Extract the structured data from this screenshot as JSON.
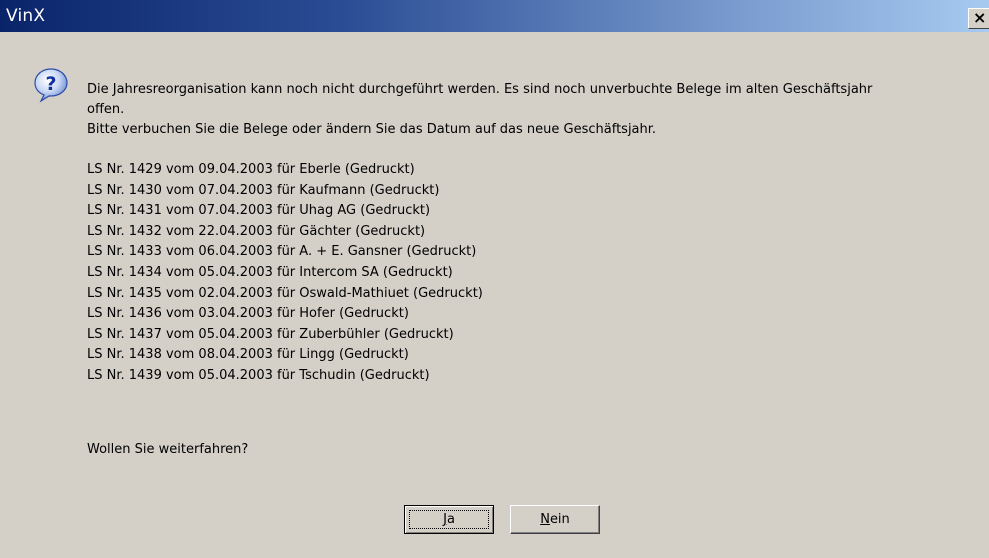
{
  "window": {
    "title": "VinX",
    "close_label": "×"
  },
  "dialog": {
    "icon": "question-icon",
    "intro_line1": "Die Jahresreorganisation kann noch nicht durchgeführt werden. Es sind noch unverbuchte Belege im alten Geschäftsjahr",
    "intro_line2": "offen.",
    "intro_line3": "Bitte verbuchen Sie die Belege oder ändern Sie das Datum auf das neue Geschäftsjahr.",
    "documents": [
      "LS Nr. 1429 vom 09.04.2003 für Eberle (Gedruckt)",
      "LS Nr. 1430 vom 07.04.2003 für Kaufmann  (Gedruckt)",
      "LS Nr. 1431 vom 07.04.2003 für Uhag AG (Gedruckt)",
      "LS Nr. 1432 vom 22.04.2003 für Gächter (Gedruckt)",
      "LS Nr. 1433 vom 06.04.2003 für A. + E. Gansner (Gedruckt)",
      "LS Nr. 1434 vom 05.04.2003 für Intercom SA (Gedruckt)",
      "LS Nr. 1435 vom 02.04.2003 für Oswald-Mathiuet (Gedruckt)",
      "LS Nr. 1436 vom 03.04.2003 für Hofer (Gedruckt)",
      "LS Nr. 1437 vom 05.04.2003 für Zuberbühler (Gedruckt)",
      "LS Nr. 1438 vom 08.04.2003 für Lingg (Gedruckt)",
      "LS Nr. 1439 vom 05.04.2003 für Tschudin (Gedruckt)"
    ],
    "question": "Wollen Sie weiterfahren?"
  },
  "buttons": {
    "yes_mnemonic": "J",
    "yes_rest": "a",
    "no_mnemonic": "N",
    "no_rest": "ein"
  }
}
